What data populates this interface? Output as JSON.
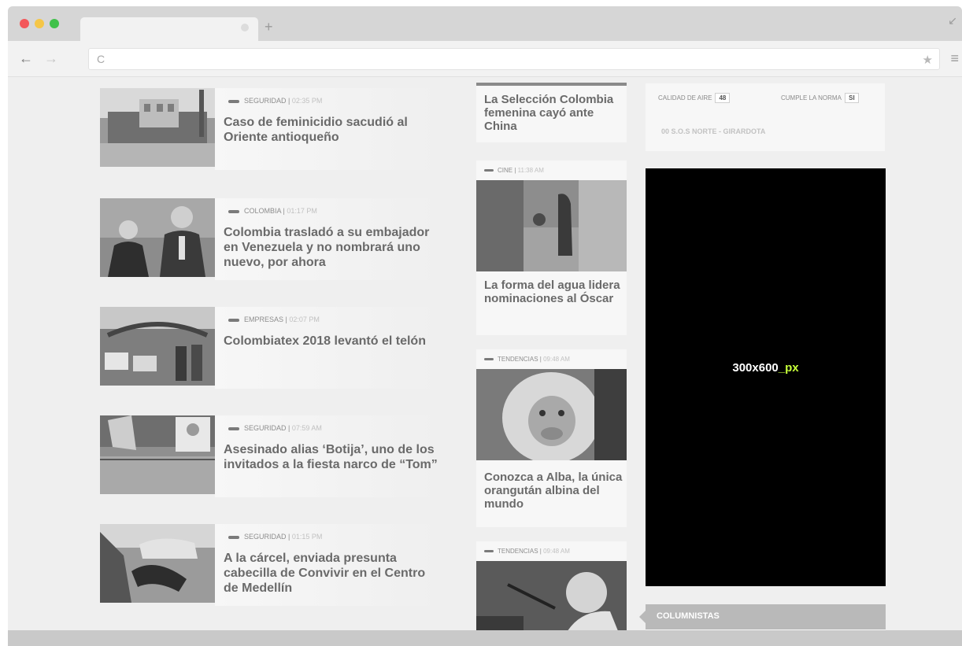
{
  "browser": {
    "new_tab_symbol": "+",
    "back_symbol": "←",
    "forward_symbol": "→",
    "reload_symbol": "C",
    "star_symbol": "★",
    "menu_symbol": "≡",
    "resize_symbol": "↙"
  },
  "articles": [
    {
      "category": "SEGURIDAD",
      "time": "02:35 PM",
      "title": "Caso de feminicidio sacudió al Oriente antioqueño"
    },
    {
      "category": "COLOMBIA",
      "time": "01:17 PM",
      "title": "Colombia trasladó a su embajador en Venezuela y no nombrará uno nuevo, por ahora"
    },
    {
      "category": "EMPRESAS",
      "time": "02:07 PM",
      "title": "Colombiatex 2018 levantó el telón"
    },
    {
      "category": "SEGURIDAD",
      "time": "07:59 AM",
      "title": "Asesinado alias ‘Botija’, uno de los invitados a la fiesta narco de “Tom”"
    },
    {
      "category": "SEGURIDAD",
      "time": "01:15 PM",
      "title": "A la cárcel, enviada presunta cabecilla de Convivir en el Centro de Medellín"
    }
  ],
  "middle": {
    "top_title": "La Selección Colombia femenina cayó ante China",
    "cards": [
      {
        "category": "CINE",
        "time": "11:38 AM",
        "title": "La forma del agua lidera nominaciones al Óscar"
      },
      {
        "category": "TENDENCIAS",
        "time": "09:48 AM",
        "title": "Conozca a Alba, la única orangután albina del mundo"
      },
      {
        "category": "TENDENCIAS",
        "time": "09:48 AM",
        "title": ""
      }
    ]
  },
  "sidebar": {
    "air_quality_label": "CALIDAD DE AIRE",
    "air_quality_value": "48",
    "norm_label": "CUMPLE LA NORMA",
    "norm_value": "SI",
    "station": "S.O.S NORTE - GIRARDOTA",
    "station_code": "00",
    "ad_text": "300x600",
    "ad_suffix": "_px",
    "columnists_label": "COLUMNISTAS"
  }
}
